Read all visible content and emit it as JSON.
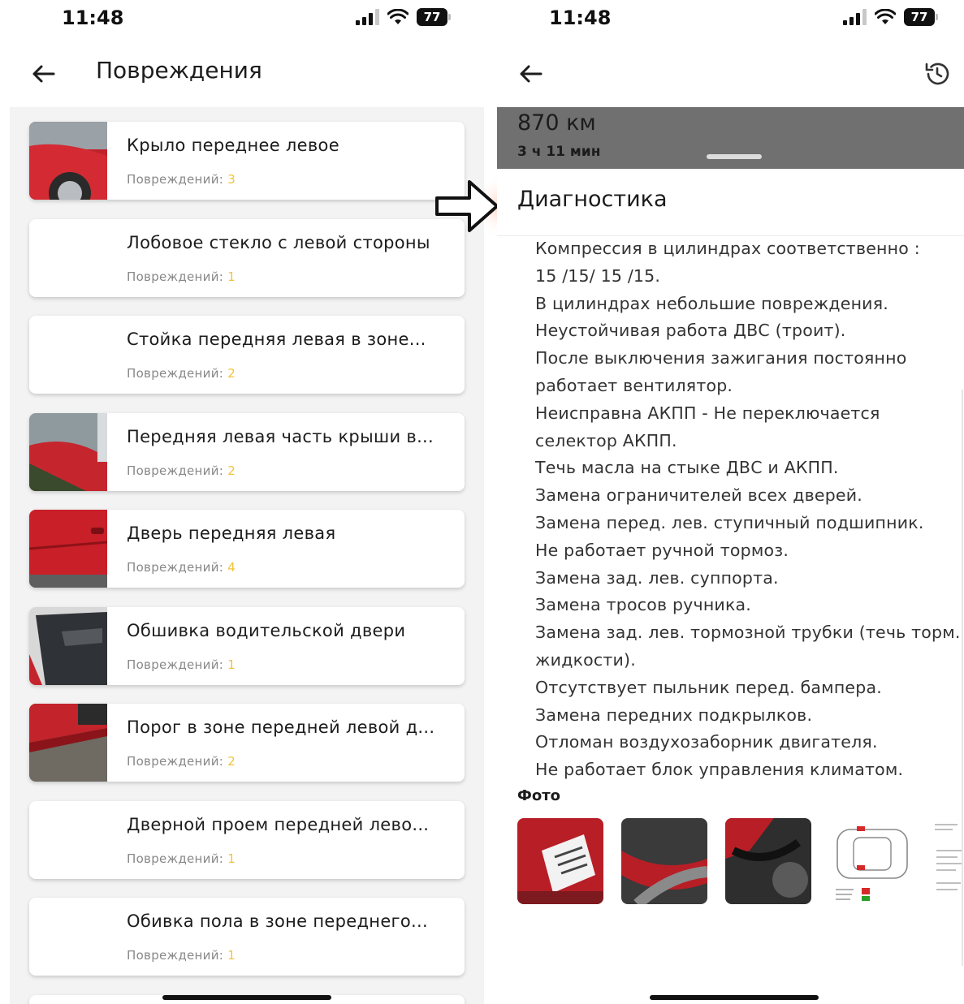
{
  "status": {
    "time": "11:48",
    "battery": "77"
  },
  "left": {
    "title": "Повреждения",
    "items": [
      {
        "title": "Крыло переднее левое",
        "label": "Повреждений:",
        "count": "3",
        "has_photo": true
      },
      {
        "title": "Лобовое стекло с левой стороны",
        "label": "Повреждений:",
        "count": "1",
        "has_photo": false
      },
      {
        "title": "Стойка передняя левая в зоне...",
        "label": "Повреждений:",
        "count": "2",
        "has_photo": false
      },
      {
        "title": "Передняя левая часть крыши в...",
        "label": "Повреждений:",
        "count": "2",
        "has_photo": true
      },
      {
        "title": "Дверь передняя левая",
        "label": "Повреждений:",
        "count": "4",
        "has_photo": true
      },
      {
        "title": "Обшивка водительской двери",
        "label": "Повреждений:",
        "count": "1",
        "has_photo": true
      },
      {
        "title": "Порог в зоне передней левой д...",
        "label": "Повреждений:",
        "count": "2",
        "has_photo": true
      },
      {
        "title": "Дверной проем передней лево...",
        "label": "Повреждений:",
        "count": "1",
        "has_photo": false
      },
      {
        "title": "Обивка пола в зоне переднего...",
        "label": "Повреждений:",
        "count": "1",
        "has_photo": false
      }
    ]
  },
  "right": {
    "distance": "870 км",
    "duration": "3 ч 11 мин",
    "sheet_title": "Диагностика",
    "diagnostics_lines": [
      "Компрессия в цилиндрах соответственно :",
      "15 /15/ 15 /15.",
      "В цилиндрах небольшие повреждения.",
      "Неустойчивая работа ДВС (троит).",
      "После выключения зажигания постоянно",
      "работает вентилятор.",
      "Неисправна АКПП - Не переключается",
      "селектор АКПП.",
      "Течь масла на стыке ДВС и АКПП.",
      "Замена ограничителей всех дверей.",
      "Замена перед. лев. ступичный подшипник.",
      "Не работает ручной тормоз.",
      "Замена зад. лев. суппорта.",
      "Замена тросов ручника.",
      "Замена зад. лев. тормозной трубки (течь торм.",
      "жидкости).",
      "Отсутствует пыльник перед. бампера.",
      "Замена передних подкрылков.",
      "Отломан воздухозаборник двигателя.",
      "Не работает блок управления климатом."
    ],
    "photo_label": "Фото"
  },
  "colors": {
    "accent_count": "#f2c33a",
    "map_strip": "#707070",
    "arrow_glow": "#ffd2c2"
  }
}
